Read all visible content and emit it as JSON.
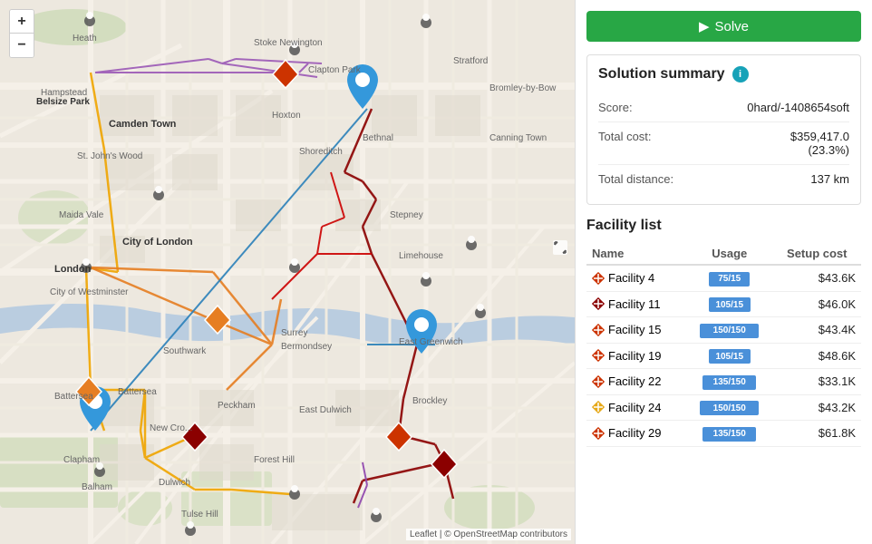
{
  "map": {
    "zoom_in_label": "+",
    "zoom_out_label": "−",
    "attribution_text": "Leaflet | © OpenStreetMap contributors",
    "leaflet_link": "Leaflet",
    "osm_link": "OpenStreetMap"
  },
  "solve_button": {
    "label": "Solve",
    "icon": "▶"
  },
  "solution_summary": {
    "title": "Solution summary",
    "info_icon": "i",
    "rows": [
      {
        "label": "Score:",
        "value": "0hard/-1408654soft"
      },
      {
        "label": "Total cost:",
        "value": "$359,417.0\n(23.3%)"
      },
      {
        "label": "Total distance:",
        "value": "137 km"
      }
    ]
  },
  "facility_list": {
    "title": "Facility list",
    "columns": [
      "Name",
      "Usage",
      "Setup cost"
    ],
    "facilities": [
      {
        "name": "Facility 4",
        "color": "#cc3300",
        "icon_type": "cross",
        "usage_current": 75,
        "usage_max": 150,
        "usage_label": "75/15",
        "usage_color": "#4a90d9",
        "setup_cost": "$43.6K"
      },
      {
        "name": "Facility 11",
        "color": "#8B0000",
        "icon_type": "cross",
        "usage_current": 105,
        "usage_max": 150,
        "usage_label": "105/15",
        "usage_color": "#4a90d9",
        "setup_cost": "$46.0K"
      },
      {
        "name": "Facility 15",
        "color": "#cc3300",
        "icon_type": "cross",
        "usage_current": 150,
        "usage_max": 150,
        "usage_label": "150/150",
        "usage_color": "#4a90d9",
        "setup_cost": "$43.4K"
      },
      {
        "name": "Facility 19",
        "color": "#cc3300",
        "icon_type": "cross",
        "usage_current": 105,
        "usage_max": 150,
        "usage_label": "105/15",
        "usage_color": "#4a90d9",
        "setup_cost": "$48.6K"
      },
      {
        "name": "Facility 22",
        "color": "#cc3300",
        "icon_type": "cross",
        "usage_current": 135,
        "usage_max": 150,
        "usage_label": "135/150",
        "usage_color": "#4a90d9",
        "setup_cost": "$33.1K"
      },
      {
        "name": "Facility 24",
        "color": "#e6a817",
        "icon_type": "cross",
        "usage_current": 150,
        "usage_max": 150,
        "usage_label": "150/150",
        "usage_color": "#4a90d9",
        "setup_cost": "$43.2K"
      },
      {
        "name": "Facility 29",
        "color": "#cc3300",
        "icon_type": "cross",
        "usage_current": 135,
        "usage_max": 150,
        "usage_label": "135/150",
        "usage_color": "#4a90d9",
        "setup_cost": "$61.8K"
      }
    ]
  }
}
